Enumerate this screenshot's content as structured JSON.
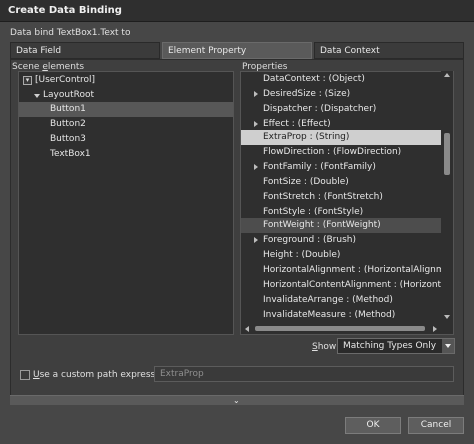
{
  "window": {
    "title": "Create Data Binding"
  },
  "subtitle": "Data bind TextBox1.Text to",
  "tabs": [
    {
      "label": "Data Field"
    },
    {
      "label": "Element Property"
    },
    {
      "label": "Data Context"
    }
  ],
  "scene": {
    "label_prefix": "Scene ",
    "label_accel": "e",
    "label_suffix": "lements",
    "items": [
      {
        "label": "[UserControl]"
      },
      {
        "label": "LayoutRoot"
      },
      {
        "label": "Button1"
      },
      {
        "label": "Button2"
      },
      {
        "label": "Button3"
      },
      {
        "label": "TextBox1"
      }
    ]
  },
  "properties": {
    "label": "Properties",
    "items": [
      {
        "label": "DataContext : (Object)"
      },
      {
        "label": "DesiredSize : (Size)"
      },
      {
        "label": "Dispatcher : (Dispatcher)"
      },
      {
        "label": "Effect : (Effect)"
      },
      {
        "label": "ExtraProp : (String)"
      },
      {
        "label": "FlowDirection : (FlowDirection)"
      },
      {
        "label": "FontFamily : (FontFamily)"
      },
      {
        "label": "FontSize : (Double)"
      },
      {
        "label": "FontStretch : (FontStretch)"
      },
      {
        "label": "FontStyle : (FontStyle)"
      },
      {
        "label": "FontWeight : (FontWeight)"
      },
      {
        "label": "Foreground : (Brush)"
      },
      {
        "label": "Height : (Double)"
      },
      {
        "label": "HorizontalAlignment : (HorizontalAlignment)"
      },
      {
        "label": "HorizontalContentAlignment : (HorizontalAlignment)"
      },
      {
        "label": "InvalidateArrange : (Method)"
      },
      {
        "label": "InvalidateMeasure : (Method)"
      }
    ]
  },
  "show": {
    "label_accel": "S",
    "label_rest": "how",
    "value": "Matching Types Only"
  },
  "custom_path": {
    "label_accel": "U",
    "label_rest": "se a custom path expression",
    "placeholder": "ExtraProp"
  },
  "buttons": {
    "ok": "OK",
    "cancel": "Cancel"
  }
}
